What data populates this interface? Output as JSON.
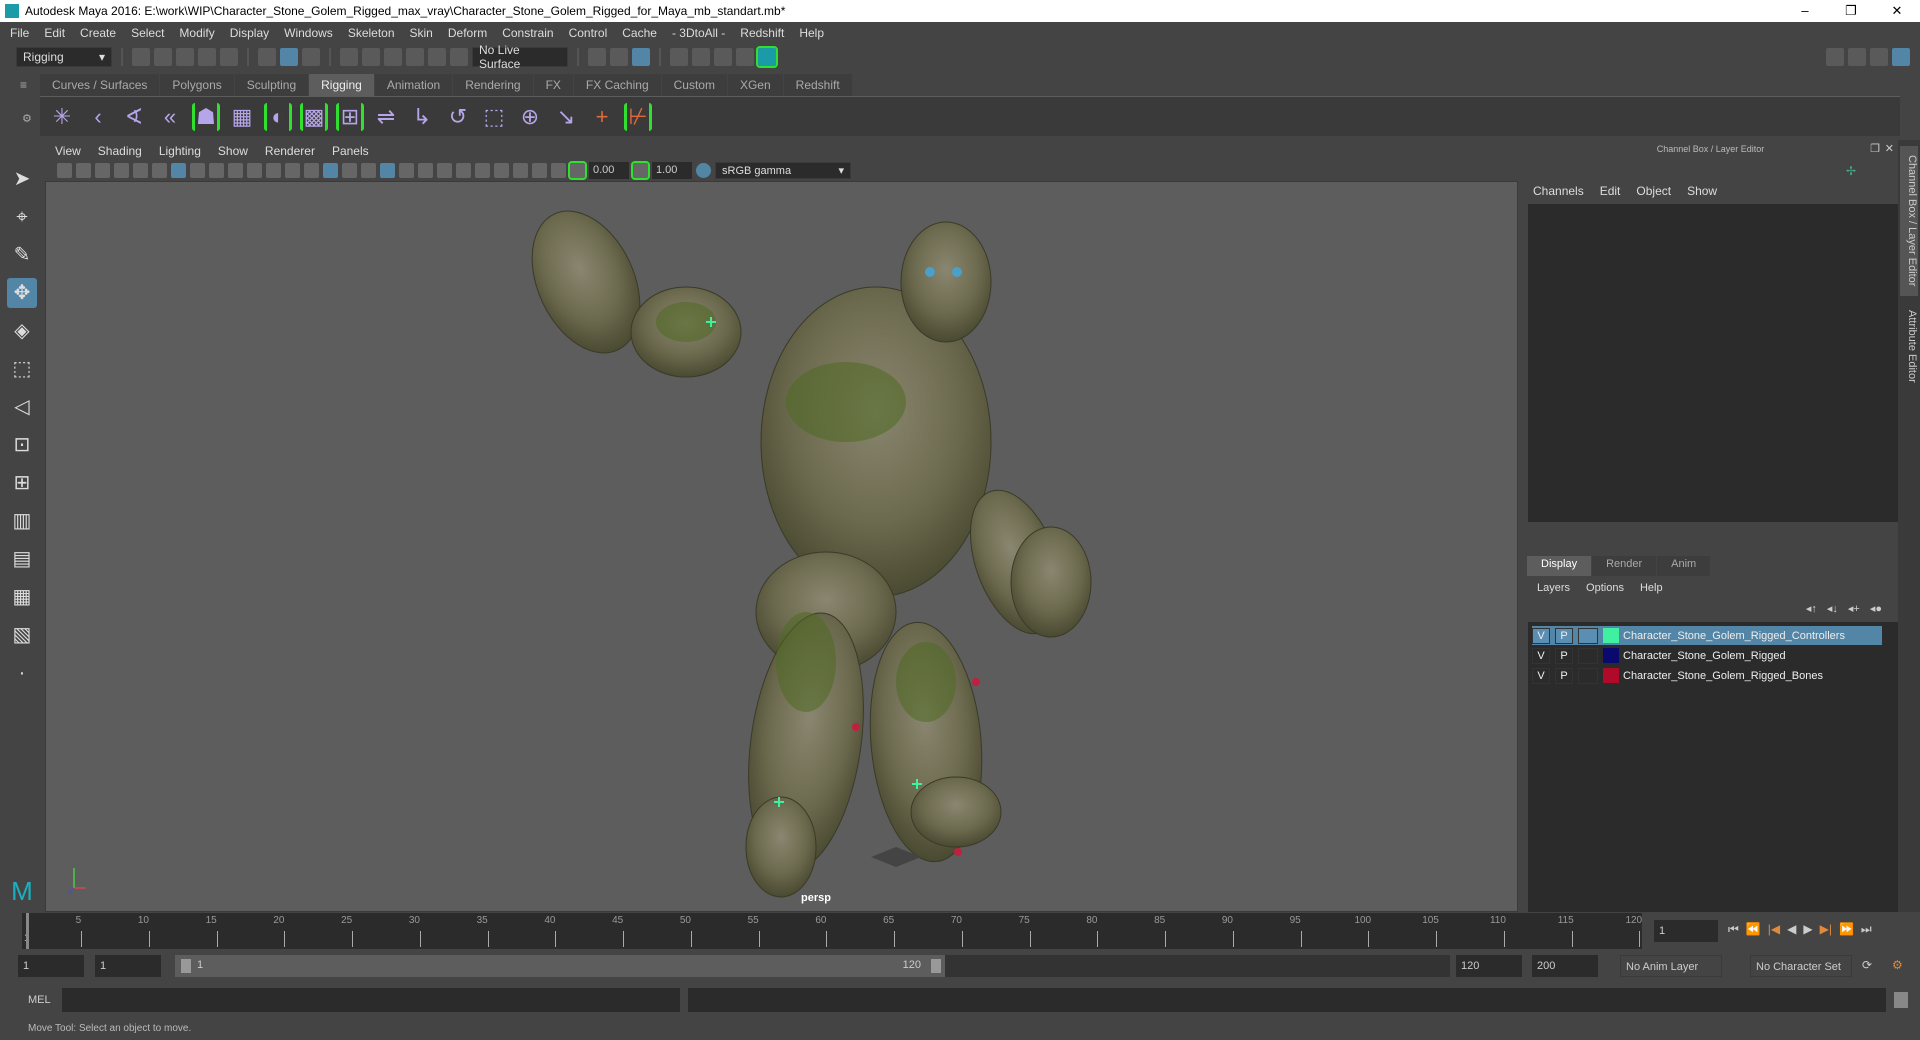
{
  "window": {
    "title": "Autodesk Maya 2016: E:\\work\\WIP\\Character_Stone_Golem_Rigged_max_vray\\Character_Stone_Golem_Rigged_for_Maya_mb_standart.mb*",
    "minimize": "–",
    "restore": "❐",
    "close": "✕"
  },
  "menus": [
    "File",
    "Edit",
    "Create",
    "Select",
    "Modify",
    "Display",
    "Windows",
    "Skeleton",
    "Skin",
    "Deform",
    "Constrain",
    "Control",
    "Cache",
    "- 3DtoAll -",
    "Redshift",
    "Help"
  ],
  "status": {
    "menuset": "Rigging",
    "live_surface": "No Live Surface"
  },
  "shelf": {
    "tabs": [
      "Curves / Surfaces",
      "Polygons",
      "Sculpting",
      "Rigging",
      "Animation",
      "Rendering",
      "FX",
      "FX Caching",
      "Custom",
      "XGen",
      "Redshift"
    ],
    "active": "Rigging"
  },
  "viewport": {
    "menus": [
      "View",
      "Shading",
      "Lighting",
      "Show",
      "Renderer",
      "Panels"
    ],
    "exposure": "0.00",
    "gamma": "1.00",
    "color_space": "sRGB gamma",
    "camera": "persp"
  },
  "panel": {
    "title": "Channel Box / Layer Editor",
    "menus": [
      "Channels",
      "Edit",
      "Object",
      "Show"
    ],
    "tabs": [
      "Display",
      "Render",
      "Anim"
    ],
    "active_tab": "Display",
    "layer_menus": [
      "Layers",
      "Options",
      "Help"
    ],
    "layers": [
      {
        "v": "V",
        "p": "P",
        "color": "#3ef0a0",
        "name": "Character_Stone_Golem_Rigged_Controllers",
        "selected": true
      },
      {
        "v": "V",
        "p": "P",
        "color": "#0a0a6e",
        "name": "Character_Stone_Golem_Rigged",
        "selected": false
      },
      {
        "v": "V",
        "p": "P",
        "color": "#b00a2a",
        "name": "Character_Stone_Golem_Rigged_Bones",
        "selected": false
      }
    ]
  },
  "side_tabs": [
    "Channel Box / Layer Editor",
    "Attribute Editor"
  ],
  "timeline": {
    "ticks": [
      5,
      10,
      15,
      20,
      25,
      30,
      35,
      40,
      45,
      50,
      55,
      60,
      65,
      70,
      75,
      80,
      85,
      90,
      95,
      100,
      105,
      110,
      115,
      120
    ],
    "start_label": "1",
    "current_frame": "1"
  },
  "range": {
    "start": "1",
    "playback_start": "1",
    "slider_start": "1",
    "slider_end": "120",
    "playback_end": "120",
    "end": "200",
    "anim_layer": "No Anim Layer",
    "character_set": "No Character Set"
  },
  "mel": {
    "label": "MEL"
  },
  "statusline": "Move Tool: Select an object to move."
}
